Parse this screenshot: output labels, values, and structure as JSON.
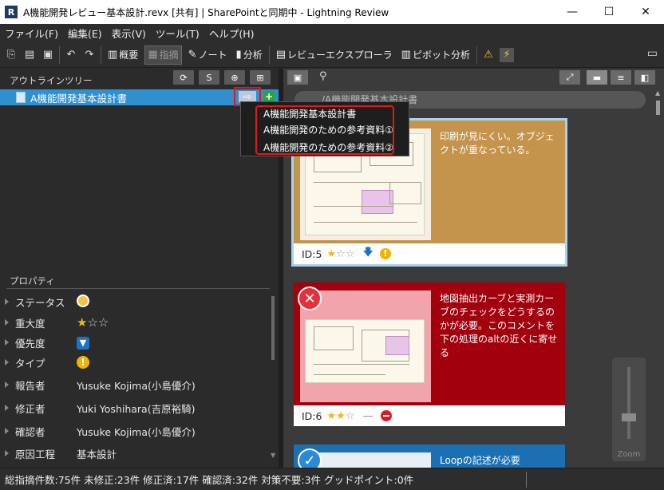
{
  "window": {
    "title": "A機能開発レビュー基本設計.revx [共有] | SharePointと同期中 - Lightning Review",
    "logo_letter": "R",
    "minimize": "—",
    "maximize": "☐",
    "close": "✕"
  },
  "menu": [
    {
      "label": "ファイル(F)"
    },
    {
      "label": "編集(E)"
    },
    {
      "label": "表示(V)"
    },
    {
      "label": "ツール(T)"
    },
    {
      "label": "ヘルプ(H)"
    }
  ],
  "toolbar": {
    "overview": "概要",
    "indication": "指摘",
    "note": "ノート",
    "analysis": "分析",
    "review_explorer": "レビューエクスプローラ",
    "pivot_analysis": "ピボット分析"
  },
  "outline": {
    "title": "アウトラインツリー",
    "tree_item": "A機能開発基本設計書",
    "jump_symbol": "⇨",
    "add_symbol": "+"
  },
  "popup": {
    "items": [
      "A機能開発基本設計書",
      "A機能開発のための参考資料①",
      "A機能開発のための参考資料②"
    ]
  },
  "properties": {
    "title": "プロパティ",
    "rows": [
      {
        "name": "ステータス",
        "value": ""
      },
      {
        "name": "重大度",
        "value": ""
      },
      {
        "name": "優先度",
        "value": ""
      },
      {
        "name": "タイプ",
        "value": ""
      },
      {
        "name": "報告者",
        "value": "Yusuke Kojima(小島優介)"
      },
      {
        "name": "修正者",
        "value": "Yuki Yoshihara(吉原裕騎)"
      },
      {
        "name": "確認者",
        "value": "Yusuke Kojima(小島優介)"
      },
      {
        "name": "原因工程",
        "value": "基本設計"
      }
    ],
    "severity_stars": {
      "filled": 1,
      "total": 3
    }
  },
  "breadcrumb": "/A機能開発基本設計書",
  "cards": [
    {
      "id_label": "ID:5",
      "text": "印刷が見にくい。オブジェクトが重なっている。",
      "stars_filled": 1,
      "stars_total": 3
    },
    {
      "id_label": "ID:6",
      "text": "地図抽出カーブと実測カーブのチェックをどうするのかが必要。このコメントを下の処理のaltの近くに寄せる",
      "stars_filled": 2,
      "stars_total": 3
    },
    {
      "id_label": "",
      "text": "Loopの記述が必要",
      "stars_filled": 0,
      "stars_total": 3
    }
  ],
  "zoom_label": "Zoom",
  "status": "総指摘件数:75件  未修正:23件  修正済:17件  確認済:32件  対策不要:3件  グッドポイント:0件",
  "colors": {
    "card_open": "#c4934c",
    "card_rejected": "#a3000d",
    "card_done": "#1b6fb3",
    "selection": "#2f8fcf",
    "highlight": "#e01818"
  }
}
